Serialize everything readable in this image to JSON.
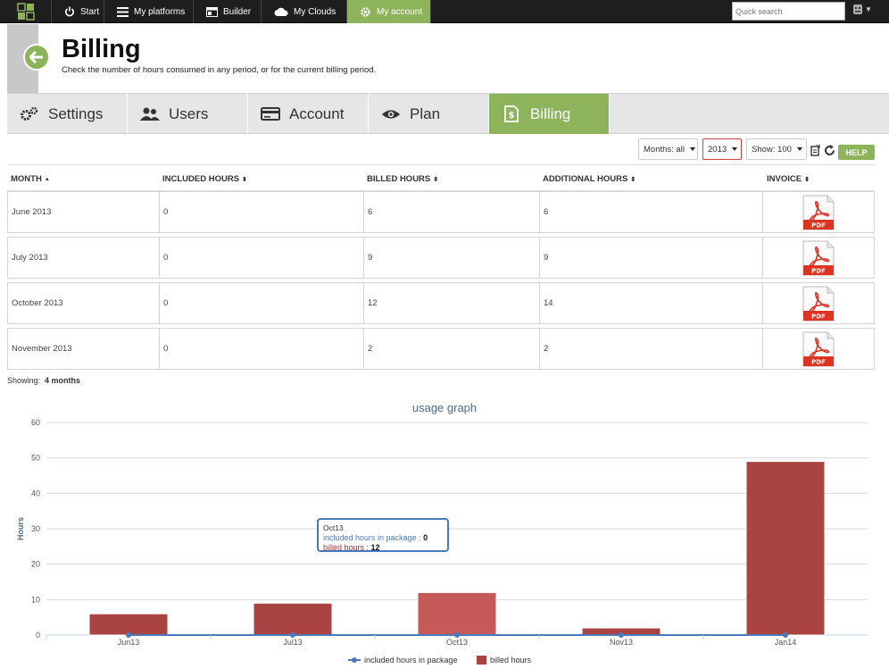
{
  "nav": {
    "items": [
      {
        "label": "Start",
        "icon": "power-icon"
      },
      {
        "label": "My platforms",
        "icon": "menu-icon"
      },
      {
        "label": "Builder",
        "icon": "builder-icon"
      },
      {
        "label": "My Clouds",
        "icon": "cloud-icon"
      },
      {
        "label": "My account",
        "icon": "gear-icon",
        "active": true
      }
    ],
    "search_placeholder": "Quick search"
  },
  "header": {
    "title": "Billing",
    "subtitle": "Check the number of hours consumed in any period, or for the current billing period."
  },
  "tabs": [
    {
      "label": "Settings",
      "icon": "gears-icon"
    },
    {
      "label": "Users",
      "icon": "users-icon"
    },
    {
      "label": "Account",
      "icon": "card-icon"
    },
    {
      "label": "Plan",
      "icon": "eye-icon"
    },
    {
      "label": "Billing",
      "icon": "dollar-doc-icon",
      "active": true
    }
  ],
  "toolbar": {
    "months": "Months: all",
    "year": "2013",
    "show": "Show: 100",
    "help": "HELP"
  },
  "table": {
    "headers": [
      "MONTH",
      "INCLUDED HOURS",
      "BILLED HOURS",
      "ADDITIONAL HOURS",
      "INVOICE"
    ],
    "rows": [
      {
        "month": "June 2013",
        "included": "0",
        "billed": "6",
        "additional": "6"
      },
      {
        "month": "July 2013",
        "included": "0",
        "billed": "9",
        "additional": "9"
      },
      {
        "month": "October 2013",
        "included": "0",
        "billed": "12",
        "additional": "14"
      },
      {
        "month": "November 2013",
        "included": "0",
        "billed": "2",
        "additional": "2"
      }
    ],
    "pdf_label": "PDF"
  },
  "showing": {
    "label": "Showing:",
    "value": "4 months"
  },
  "chart_data": {
    "type": "bar",
    "title": "usage graph",
    "ylabel": "Hours",
    "xlabel": "",
    "ylim": [
      0,
      60
    ],
    "yticks": [
      0,
      10,
      20,
      30,
      40,
      50,
      60
    ],
    "categories": [
      "Jun13",
      "Jul13",
      "Oct13",
      "Nov13",
      "Jan14"
    ],
    "series": [
      {
        "name": "included hours in package",
        "type": "line",
        "color": "#4a7bb8",
        "values": [
          0,
          0,
          0,
          0,
          0
        ]
      },
      {
        "name": "billed hours",
        "type": "bar",
        "color": "#a94442",
        "values": [
          6,
          9,
          12,
          2,
          49
        ]
      }
    ],
    "highlighted_index": 2,
    "tooltip": {
      "title": "Oct13",
      "included_label": "included hours in package :",
      "included_value": "0",
      "billed_label": "billed hours :",
      "billed_value": "12"
    },
    "legend": "bottom",
    "grid": true
  }
}
